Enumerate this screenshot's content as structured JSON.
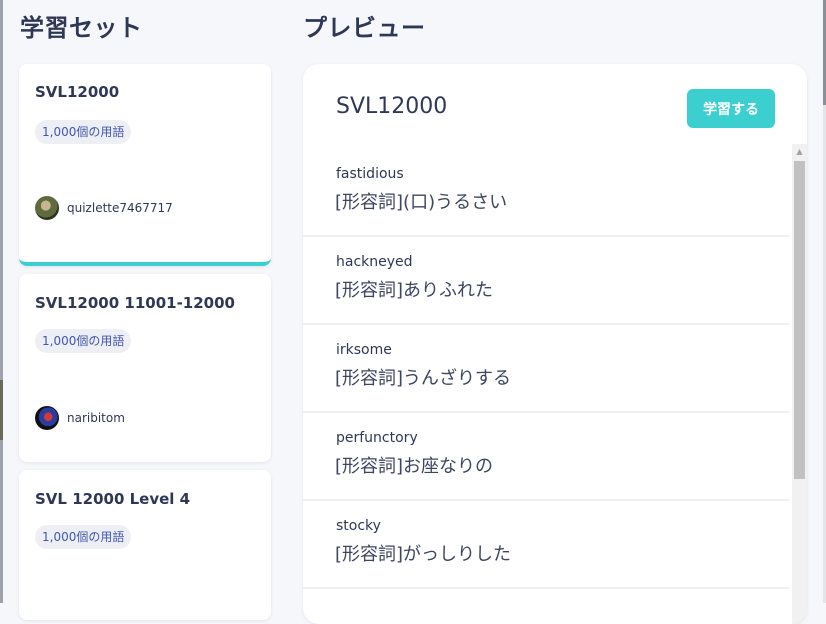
{
  "sets_panel": {
    "heading": "学習セット",
    "cards": [
      {
        "title": "SVL12000",
        "terms": "1,000個の用語",
        "author": "quizlette7467717",
        "active": true
      },
      {
        "title": "SVL12000 11001-12000",
        "terms": "1,000個の用語",
        "author": "naribitom",
        "active": false
      },
      {
        "title": "SVL 12000 Level 4",
        "terms": "1,000個の用語",
        "author": "",
        "active": false
      }
    ]
  },
  "preview": {
    "heading": "プレビュー",
    "title": "SVL12000",
    "study_button": "学習する",
    "terms": [
      {
        "word": "fastidious",
        "definition": "[形容詞](口)うるさい"
      },
      {
        "word": "hackneyed",
        "definition": "[形容詞]ありふれた"
      },
      {
        "word": "irksome",
        "definition": "[形容詞]うんざりする"
      },
      {
        "word": "perfunctory",
        "definition": "[形容詞]お座なりの"
      },
      {
        "word": "stocky",
        "definition": "[形容詞]がっしりした"
      }
    ]
  },
  "colors": {
    "accent": "#3ccfcf",
    "text": "#2e3856",
    "badge_text": "#4257b2",
    "background": "#f6f7fb"
  }
}
